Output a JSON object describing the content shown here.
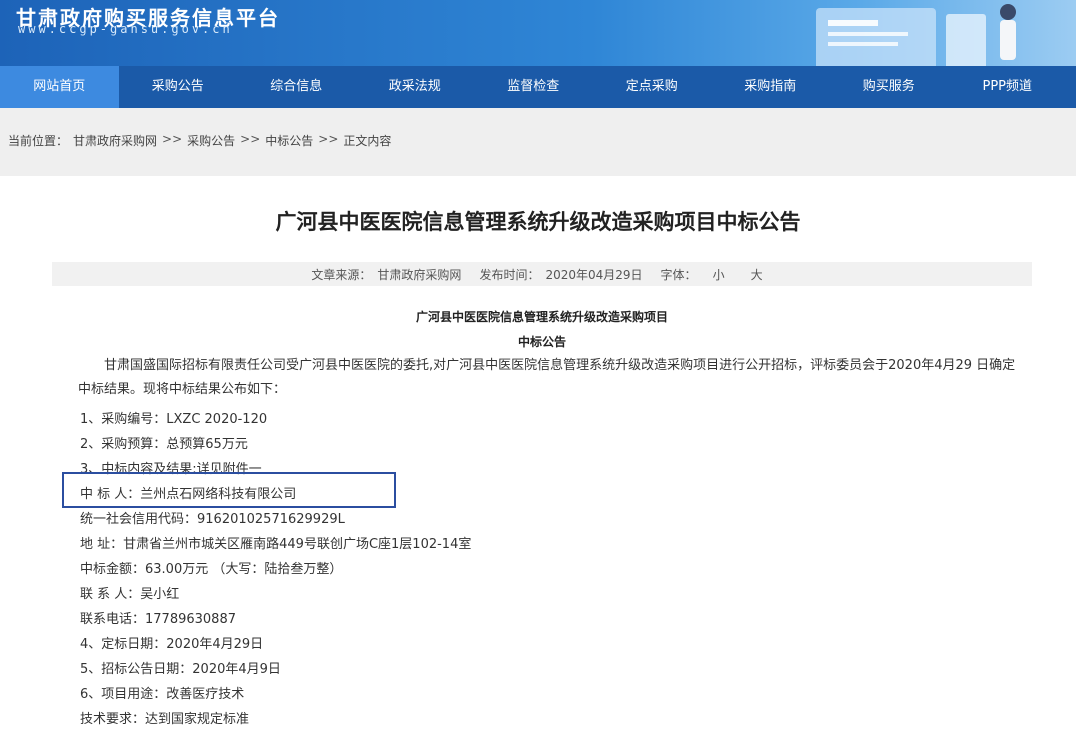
{
  "site": {
    "name_cn": "甘肃政府购买服务信息平台",
    "url": "www.ccgp-gansu.gov.cn"
  },
  "nav": {
    "items": [
      {
        "label": "网站首页",
        "active": true
      },
      {
        "label": "采购公告"
      },
      {
        "label": "综合信息"
      },
      {
        "label": "政采法规"
      },
      {
        "label": "监督检查"
      },
      {
        "label": "定点采购"
      },
      {
        "label": "采购指南"
      },
      {
        "label": "购买服务"
      },
      {
        "label": "PPP频道"
      }
    ]
  },
  "breadcrumb": {
    "prefix": "当前位置：",
    "items": [
      "甘肃政府采购网",
      "采购公告",
      "中标公告",
      "正文内容"
    ],
    "separator": ">>"
  },
  "article": {
    "title": "广河县中医医院信息管理系统升级改造采购项目中标公告",
    "meta": {
      "source_label": "文章来源：",
      "source": "甘肃政府采购网",
      "date_label": "发布时间：",
      "date": "2020年04月29日",
      "font_label": "字体：",
      "font_small": "小",
      "font_large": "大"
    },
    "heading1": "广河县中医医院信息管理系统升级改造采购项目",
    "heading2": "中标公告",
    "intro": "甘肃国盛国际招标有限责任公司受广河县中医医院的委托,对广河县中医医院信息管理系统升级改造采购项目进行公开招标，评标委员会于2020年4月29 日确定中标结果。现将中标结果公布如下：",
    "lines": [
      "1、采购编号：LXZC 2020-120",
      "2、采购预算：总预算65万元",
      "3、中标内容及结果:详见附件一",
      "中 标 人：兰州点石网络科技有限公司",
      "统一社会信用代码：91620102571629929L",
      "地  址：甘肃省兰州市城关区雁南路449号联创广场C座1层102-14室",
      "中标金额：63.00万元  （大写：陆拾叁万整）",
      "联 系 人：吴小红",
      "联系电话：17789630887",
      "4、定标日期：2020年4月29日",
      "5、招标公告日期：2020年4月9日",
      "6、项目用途：改善医疗技术",
      "  技术要求：达到国家规定标准"
    ]
  },
  "colors": {
    "nav_bg": "#1b5aa8",
    "nav_active": "#3d8ae0",
    "highlight_border": "#2b4ea0"
  }
}
